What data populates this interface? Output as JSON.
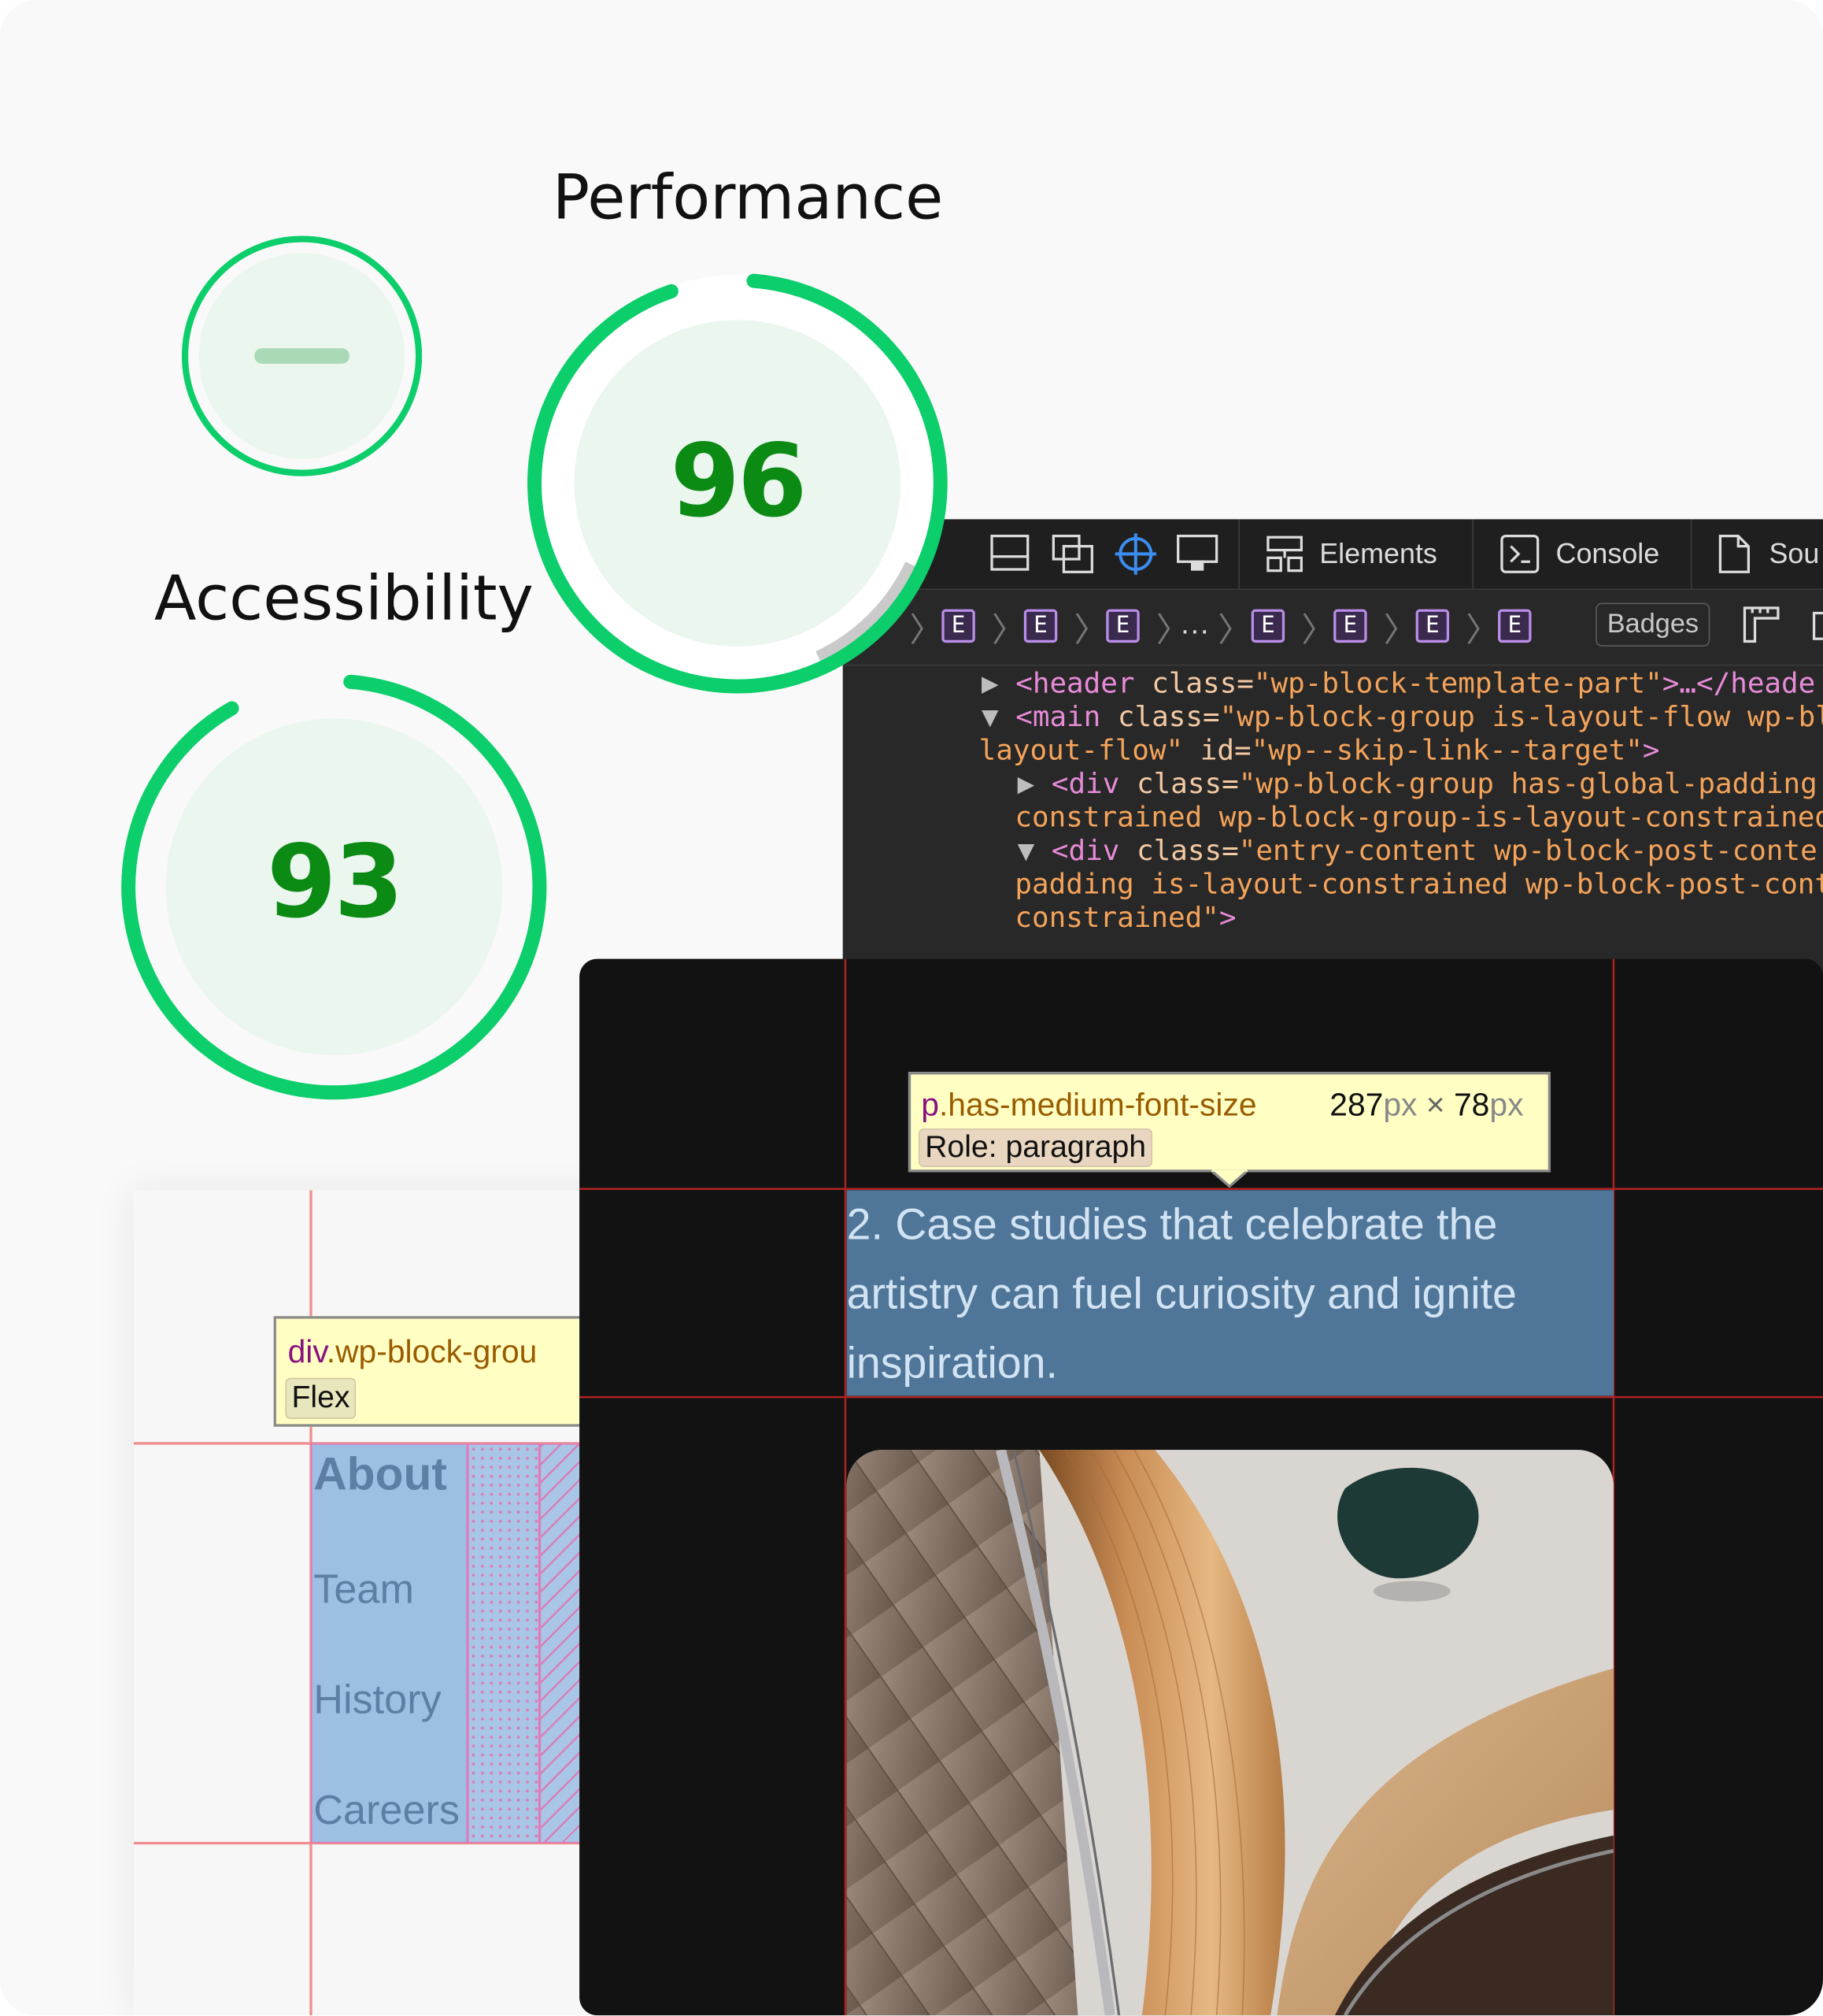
{
  "gauges": {
    "empty": {
      "state": "not-applicable",
      "color": "#0cce6b"
    },
    "performance": {
      "label": "Performance",
      "score": "96",
      "value": 96,
      "color": "#0cce6b",
      "text_color": "#0b8a14"
    },
    "accessibility": {
      "label": "Accessibility",
      "score": "93",
      "value": 93,
      "color": "#0cce6b",
      "text_color": "#0b8a14"
    }
  },
  "devtools": {
    "toolbar_icons": [
      "dock-side-icon",
      "dock-bottom-icon",
      "undock-icon",
      "inspect-element-icon",
      "device-toolbar-icon"
    ],
    "tabs": [
      {
        "label": "Elements",
        "icon": "elements-icon"
      },
      {
        "label": "Console",
        "icon": "console-icon"
      },
      {
        "label": "Sou",
        "icon": "sources-icon"
      }
    ],
    "breadcrumb_badge": "E",
    "breadcrumb_ellipsis": "…",
    "badges_button": "Badges",
    "code": {
      "l1_tag_open": "<header ",
      "l1_attr": "class=",
      "l1_val": "\"wp-block-template-part\"",
      "l1_tail": ">…</heade",
      "l2_tag_open": "<main ",
      "l2_attr": "class=",
      "l2_val": "\"wp-block-group is-layout-flow wp-bl",
      "l3_val": "layout-flow\"",
      "l3_attr": " id=",
      "l3_val2": "\"wp--skip-link--target\"",
      "l3_tail": ">",
      "l4_tag_open": "<div ",
      "l4_attr": "class=",
      "l4_val": "\"wp-block-group has-global-padding",
      "l5_val": "constrained wp-block-group-is-layout-constrained",
      "l6_tag_open": "<div ",
      "l6_attr": "class=",
      "l6_val": "\"entry-content wp-block-post-conte",
      "l7_val": "padding is-layout-constrained wp-block-post-cont",
      "l8_val": "constrained\"",
      "l8_tail": ">"
    }
  },
  "inspector_tooltip": {
    "tag": "p",
    "class": ".has-medium-font-size",
    "width": "287",
    "height": "78",
    "unit": "px",
    "times": "×",
    "role": "Role: paragraph"
  },
  "selected_paragraph": {
    "line1": "2. Case studies that celebrate the",
    "line2": "artistry can fuel curiosity and ignite",
    "line3": "inspiration."
  },
  "flex_tooltip": {
    "tag": "div",
    "class": ".wp-block-grou",
    "badge": "Flex"
  },
  "nav": {
    "items": [
      "About",
      "Team",
      "History",
      "Careers"
    ]
  }
}
